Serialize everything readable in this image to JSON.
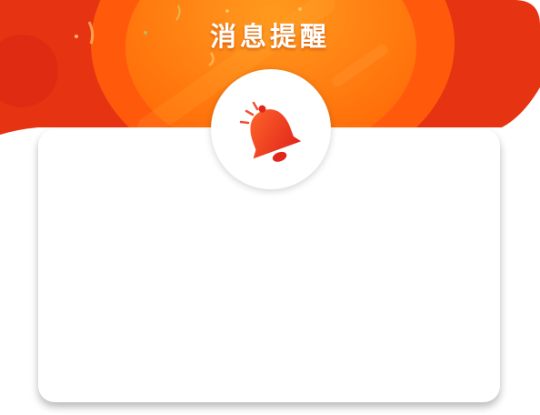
{
  "dialog": {
    "title": "消息提醒"
  },
  "icons": {
    "badge_icon": "bell-icon"
  },
  "colors": {
    "banner_red": "#E63312",
    "banner_orange": "#FF7A0C",
    "bell_red": "#E8331B",
    "title_text": "#FFFFFF"
  }
}
